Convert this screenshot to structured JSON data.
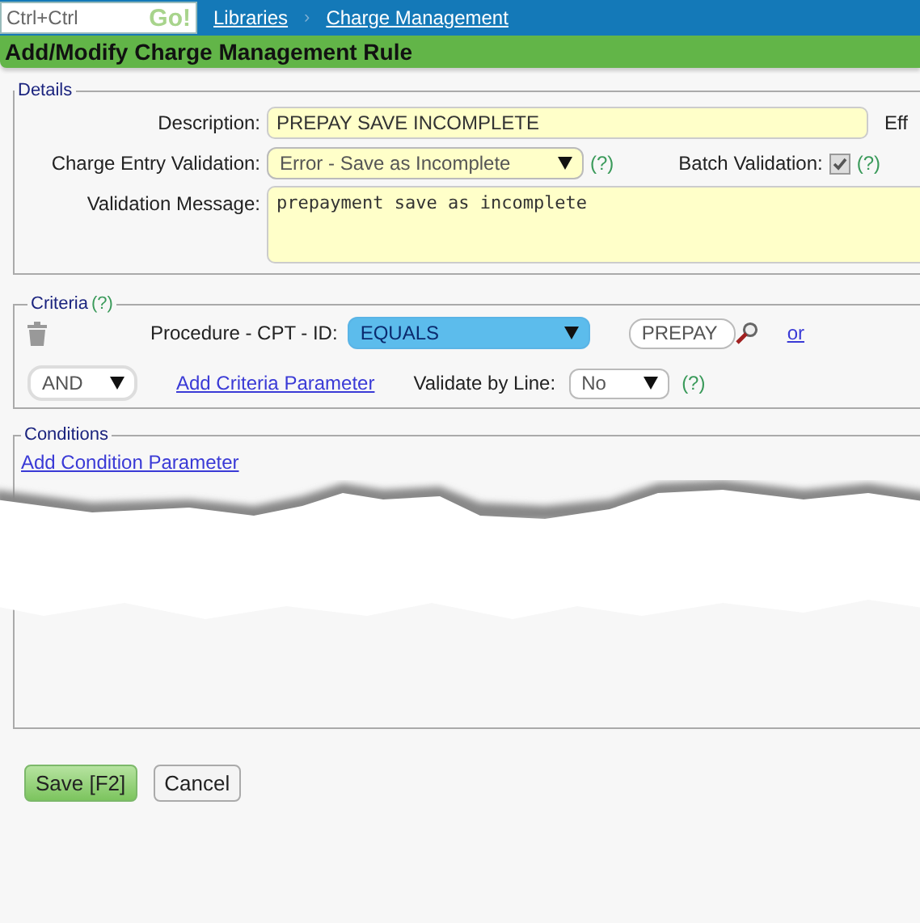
{
  "top_bar": {
    "search": {
      "value": "Ctrl+Ctrl"
    },
    "go_button": "Go!",
    "breadcrumbs": [
      {
        "label": "Libraries"
      },
      {
        "label": "Charge Management"
      }
    ],
    "separator": "›"
  },
  "page_title": "Add/Modify Charge Management Rule",
  "details": {
    "legend": "Details",
    "description": {
      "label": "Description:",
      "value": "PREPAY SAVE INCOMPLETE"
    },
    "cut_label": "Eff",
    "charge_entry_validation": {
      "label": "Charge Entry Validation:",
      "value": "Error - Save as Incomplete",
      "help": "(?)"
    },
    "batch_validation": {
      "label": "Batch Validation:",
      "checked": true,
      "disabled": true,
      "help": "(?)"
    },
    "validation_message": {
      "label": "Validation Message:",
      "value": "prepayment save as incomplete"
    }
  },
  "criteria": {
    "legend": "Criteria",
    "help": "(?)",
    "rows": [
      {
        "field": "Procedure - CPT - ID:",
        "operator": "EQUALS",
        "value": "PREPAY",
        "or_link": "or"
      }
    ],
    "joiner": "AND",
    "add_link": "Add Criteria Parameter",
    "validate_by_line": {
      "label": "Validate by Line:",
      "value": "No",
      "help": "(?)"
    }
  },
  "conditions": {
    "legend": "Conditions",
    "add_link": "Add Condition Parameter"
  },
  "buttons": [
    {
      "label": "Save [F2]",
      "kind": "primary"
    },
    {
      "label": "Cancel",
      "kind": "secondary"
    }
  ]
}
